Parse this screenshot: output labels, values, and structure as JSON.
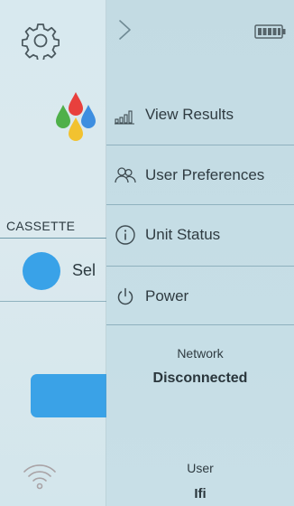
{
  "home": {
    "cassette_label": "CASSETTE",
    "cassette_select_text": "Sel",
    "icons": {
      "settings": "gear-icon",
      "logo": "color-drops-logo-icon",
      "wifi": "wifi-icon"
    }
  },
  "menu": {
    "icons": {
      "back": "chevron-right-icon",
      "battery": "battery-icon"
    },
    "items": [
      {
        "label": "View Results",
        "icon": "bar-chart-icon"
      },
      {
        "label": "User Preferences",
        "icon": "users-icon"
      },
      {
        "label": "Unit Status",
        "icon": "info-icon"
      },
      {
        "label": "Power",
        "icon": "power-icon"
      }
    ],
    "network": {
      "title": "Network",
      "status": "Disconnected"
    },
    "user": {
      "title": "User",
      "name": "Ifi"
    }
  },
  "colors": {
    "accent_blue": "#39a2e8",
    "menu_background": "#c5dde5",
    "home_background": "#dbe9ee",
    "text": "#2f3b41",
    "divider": "#8fb1be",
    "drop_red": "#e8403d",
    "drop_blue": "#3d8ee0",
    "drop_green": "#4fb04a",
    "drop_yellow": "#f2c230"
  }
}
